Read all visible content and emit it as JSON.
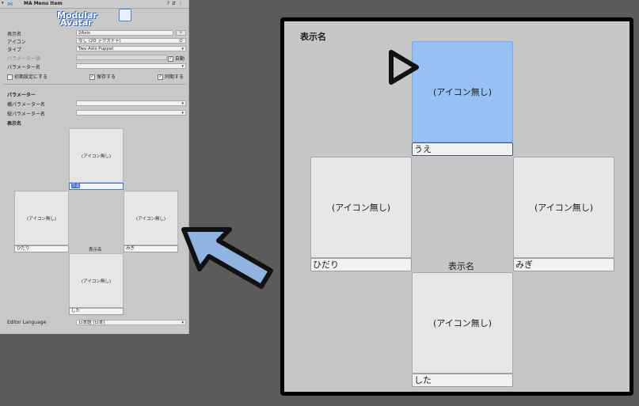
{
  "inspector": {
    "component_title": "MA Menu Item",
    "logo_text": [
      "Modular",
      "Avatar"
    ],
    "fields": {
      "display_name": {
        "label": "表示名",
        "value": "2Axis"
      },
      "icon": {
        "label": "アイコン",
        "value": "なし (2D テクスチャ)"
      },
      "type": {
        "label": "タイプ",
        "value": "Two Axis Puppet"
      },
      "param_value": {
        "label": "パラメーター値",
        "auto_label": "自動"
      },
      "param_name": {
        "label": "パラメーター名"
      }
    },
    "checks": {
      "default_label": "初期設定にする",
      "save_label": "保存する",
      "sync_label": "同期する"
    },
    "params_section": "パラメーター",
    "h_param_label": "横パラメーター名",
    "v_param_label": "縦パラメーター名",
    "display_section": "表示名",
    "cells": {
      "no_icon": "(アイコン無し)",
      "up": "うえ",
      "left": "ひだり",
      "right": "みぎ",
      "down": "した",
      "center": "表示名"
    },
    "editor_language_label": "Editor Language",
    "editor_language_value": "日本語 (日本)"
  },
  "zoom": {
    "title": "表示名",
    "no_icon": "(アイコン無し)",
    "up": "うえ",
    "left": "ひだり",
    "right": "みぎ",
    "down": "した",
    "center": "表示名"
  },
  "colors": {
    "selected_cell": "#97c1f5",
    "arrow_fill": "#8fb4e2"
  }
}
